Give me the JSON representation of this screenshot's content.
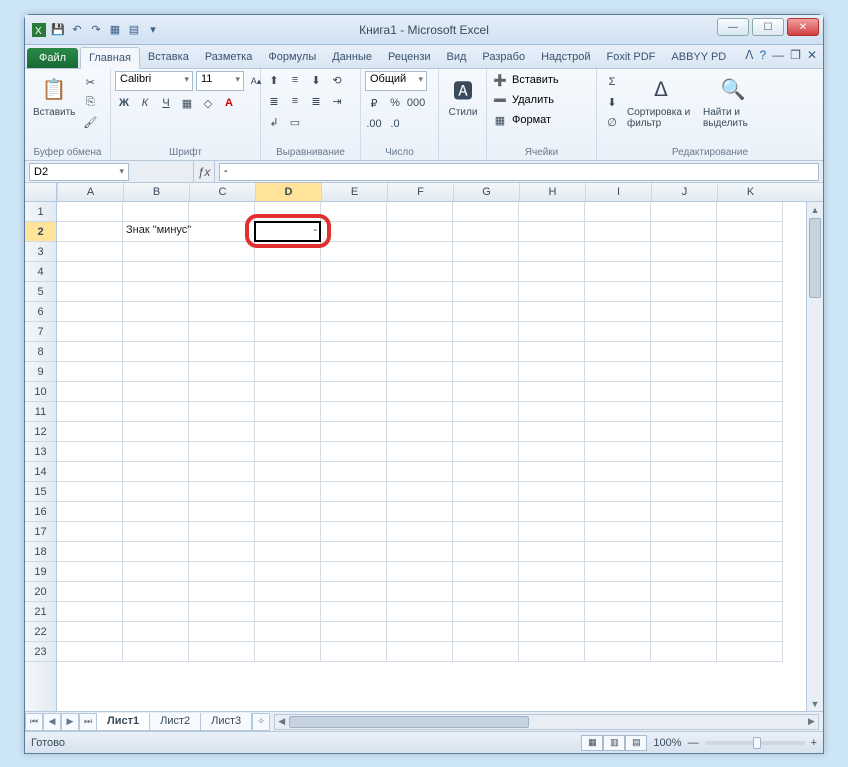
{
  "title": "Книга1  -  Microsoft Excel",
  "qat": [
    "save",
    "undo",
    "redo",
    "new",
    "open",
    "print",
    "quick"
  ],
  "file_tab": "Файл",
  "tabs": [
    "Главная",
    "Вставка",
    "Разметка",
    "Формулы",
    "Данные",
    "Рецензи",
    "Вид",
    "Разрабо",
    "Надстрой",
    "Foxit PDF",
    "ABBYY PD"
  ],
  "active_tab": 0,
  "groups": {
    "clipboard": {
      "paste": "Вставить",
      "label": "Буфер обмена"
    },
    "font": {
      "name": "Calibri",
      "size": "11",
      "label": "Шрифт"
    },
    "align": {
      "label": "Выравнивание"
    },
    "number": {
      "format": "Общий",
      "label": "Число"
    },
    "styles": {
      "btn": "Стили"
    },
    "cells": {
      "insert": "Вставить",
      "delete": "Удалить",
      "format": "Формат",
      "label": "Ячейки"
    },
    "editing": {
      "sort": "Сортировка и фильтр",
      "find": "Найти и выделить",
      "label": "Редактирование"
    }
  },
  "namebox": "D2",
  "formula": "-",
  "columns": [
    "A",
    "B",
    "C",
    "D",
    "E",
    "F",
    "G",
    "H",
    "I",
    "J",
    "K"
  ],
  "rows": 23,
  "selected": {
    "col": 3,
    "row": 1
  },
  "cell_b2": "Знак \"минус\"",
  "cell_d2": "-",
  "sheets": [
    "Лист1",
    "Лист2",
    "Лист3"
  ],
  "active_sheet": 0,
  "status_left": "Готово",
  "zoom": "100%"
}
